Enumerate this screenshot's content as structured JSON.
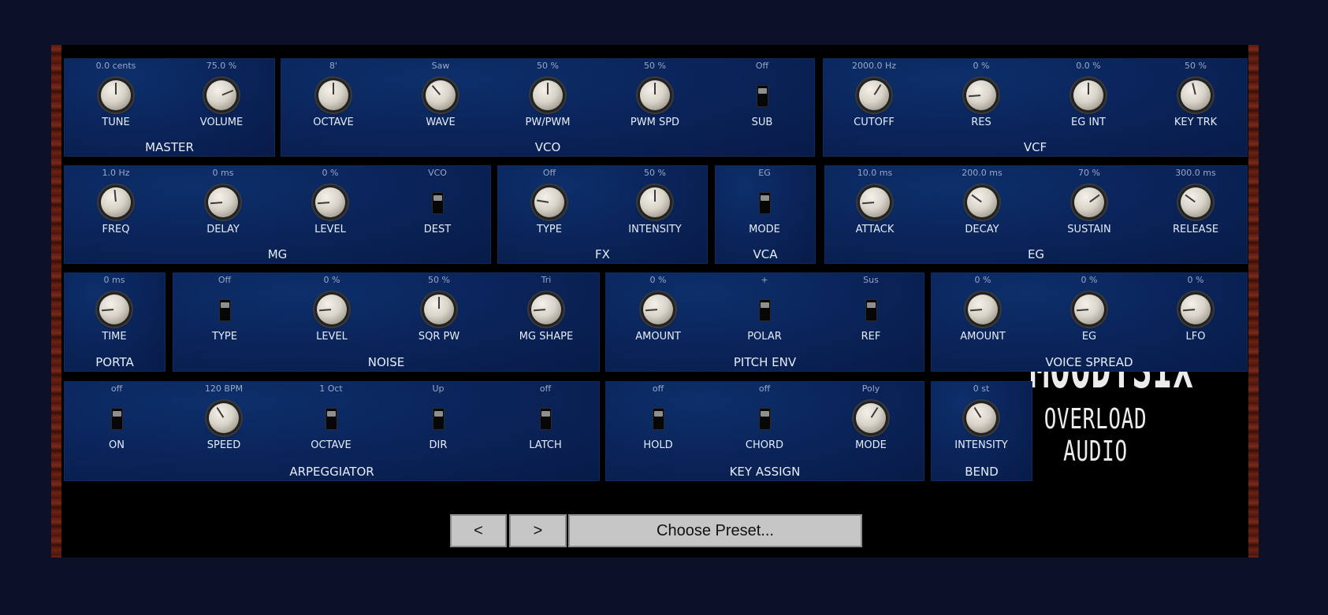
{
  "brand": {
    "name": "MOODYSIX",
    "maker": "OVERLOAD AUDIO"
  },
  "toolbar": {
    "prev_label": "<",
    "next_label": ">",
    "preset_label": "Choose Preset..."
  },
  "sections": {
    "master": {
      "title": "MASTER",
      "controls": [
        {
          "label": "TUNE",
          "value": "0.0 cents",
          "type": "knob",
          "pos": 0.5
        },
        {
          "label": "VOLUME",
          "value": "75.0 %",
          "type": "knob",
          "pos": 0.75
        }
      ]
    },
    "vco": {
      "title": "VCO",
      "controls": [
        {
          "label": "OCTAVE",
          "value": "8'",
          "type": "knob",
          "pos": 0.5
        },
        {
          "label": "WAVE",
          "value": "Saw",
          "type": "knob",
          "pos": 0.35
        },
        {
          "label": "PW/PWM",
          "value": "50 %",
          "type": "knob",
          "pos": 0.5
        },
        {
          "label": "PWM SPD",
          "value": "50 %",
          "type": "knob",
          "pos": 0.5
        },
        {
          "label": "SUB",
          "value": "Off",
          "type": "switch",
          "on": false
        }
      ]
    },
    "vcf": {
      "title": "VCF",
      "controls": [
        {
          "label": "CUTOFF",
          "value": "2000.0 Hz",
          "type": "knob",
          "pos": 0.62
        },
        {
          "label": "RES",
          "value": "0 %",
          "type": "knob",
          "pos": 0.15
        },
        {
          "label": "EG INT",
          "value": "0.0 %",
          "type": "knob",
          "pos": 0.5
        },
        {
          "label": "KEY TRK",
          "value": "50 %",
          "type": "knob",
          "pos": 0.45
        }
      ]
    },
    "mg": {
      "title": "MG",
      "controls": [
        {
          "label": "FREQ",
          "value": "1.0 Hz",
          "type": "knob",
          "pos": 0.48
        },
        {
          "label": "DELAY",
          "value": "0 ms",
          "type": "knob",
          "pos": 0.15
        },
        {
          "label": "LEVEL",
          "value": "0 %",
          "type": "knob",
          "pos": 0.15
        },
        {
          "label": "DEST",
          "value": "VCO",
          "type": "switch",
          "on": false
        }
      ]
    },
    "fx": {
      "title": "FX",
      "controls": [
        {
          "label": "TYPE",
          "value": "Off",
          "type": "knob",
          "pos": 0.2
        },
        {
          "label": "INTENSITY",
          "value": "50 %",
          "type": "knob",
          "pos": 0.5
        }
      ]
    },
    "vca": {
      "title": "VCA",
      "controls": [
        {
          "label": "MODE",
          "value": "EG",
          "type": "switch",
          "on": false
        }
      ]
    },
    "eg": {
      "title": "EG",
      "controls": [
        {
          "label": "ATTACK",
          "value": "10.0 ms",
          "type": "knob",
          "pos": 0.15
        },
        {
          "label": "DECAY",
          "value": "200.0 ms",
          "type": "knob",
          "pos": 0.3
        },
        {
          "label": "SUSTAIN",
          "value": "70 %",
          "type": "knob",
          "pos": 0.7
        },
        {
          "label": "RELEASE",
          "value": "300.0 ms",
          "type": "knob",
          "pos": 0.3
        }
      ]
    },
    "porta": {
      "title": "PORTA",
      "controls": [
        {
          "label": "TIME",
          "value": "0 ms",
          "type": "knob",
          "pos": 0.15
        }
      ]
    },
    "noise": {
      "title": "NOISE",
      "controls": [
        {
          "label": "TYPE",
          "value": "Off",
          "type": "switch",
          "on": false
        },
        {
          "label": "LEVEL",
          "value": "0 %",
          "type": "knob",
          "pos": 0.15
        },
        {
          "label": "SQR PW",
          "value": "50 %",
          "type": "knob",
          "pos": 0.5
        },
        {
          "label": "MG SHAPE",
          "value": "Tri",
          "type": "knob",
          "pos": 0.15
        }
      ]
    },
    "pitch_env": {
      "title": "PITCH ENV",
      "controls": [
        {
          "label": "AMOUNT",
          "value": "0 %",
          "type": "knob",
          "pos": 0.15
        },
        {
          "label": "POLAR",
          "value": "+",
          "type": "switch",
          "on": false
        },
        {
          "label": "REF",
          "value": "Sus",
          "type": "switch",
          "on": false
        }
      ]
    },
    "voice_spread": {
      "title": "VOICE SPREAD",
      "controls": [
        {
          "label": "AMOUNT",
          "value": "0 %",
          "type": "knob",
          "pos": 0.15
        },
        {
          "label": "EG",
          "value": "0 %",
          "type": "knob",
          "pos": 0.15
        },
        {
          "label": "LFO",
          "value": "0 %",
          "type": "knob",
          "pos": 0.15
        }
      ]
    },
    "arpeggiator": {
      "title": "ARPEGGIATOR",
      "controls": [
        {
          "label": "ON",
          "value": "off",
          "type": "switch",
          "on": false
        },
        {
          "label": "SPEED",
          "value": "120 BPM",
          "type": "knob",
          "pos": 0.38
        },
        {
          "label": "OCTAVE",
          "value": "1 Oct",
          "type": "switch",
          "on": false
        },
        {
          "label": "DIR",
          "value": "Up",
          "type": "switch",
          "on": false
        },
        {
          "label": "LATCH",
          "value": "off",
          "type": "switch",
          "on": false
        }
      ]
    },
    "key_assign": {
      "title": "KEY ASSIGN",
      "controls": [
        {
          "label": "HOLD",
          "value": "off",
          "type": "switch",
          "on": false
        },
        {
          "label": "CHORD",
          "value": "off",
          "type": "switch",
          "on": false
        },
        {
          "label": "MODE",
          "value": "Poly",
          "type": "knob",
          "pos": 0.62
        }
      ]
    },
    "bend": {
      "title": "BEND",
      "controls": [
        {
          "label": "INTENSITY",
          "value": "0 st",
          "type": "knob",
          "pos": 0.38
        }
      ]
    }
  }
}
